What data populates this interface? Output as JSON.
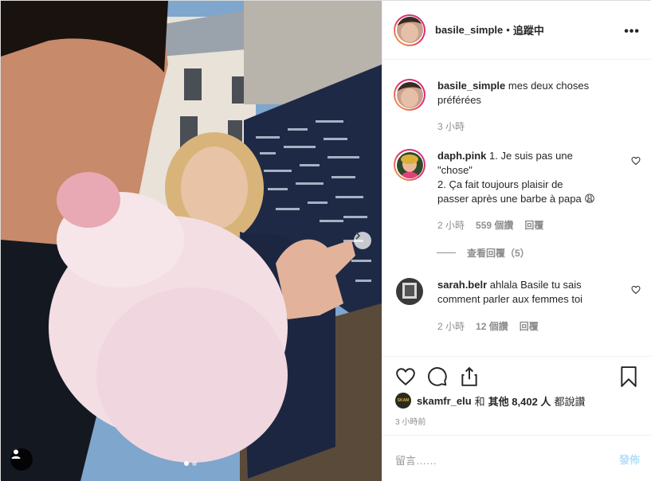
{
  "post": {
    "carousel": {
      "slide_count": 2,
      "active_slide": 1
    }
  },
  "header": {
    "username": "basile_simple",
    "separator": "•",
    "follow_status": "追蹤中",
    "more_icon": "more-horizontal-icon"
  },
  "caption": {
    "username": "basile_simple",
    "text": "mes deux choses préférées",
    "time": "3 小時"
  },
  "comments": [
    {
      "username": "daph.pink",
      "text_lines": [
        "1. Je suis pas une",
        "\"chose\"",
        "2. Ça fait toujours plaisir de",
        "passer après une barbe à papa 😩"
      ],
      "time": "2 小時",
      "likes": "559 個讚",
      "reply": "回覆",
      "view_replies": "查看回覆（5）"
    },
    {
      "username": "sarah.belr",
      "text_lines": [
        "ahlala Basile tu sais",
        "comment parler aux femmes toi"
      ],
      "time": "2 小時",
      "likes": "12 個讚",
      "reply": "回覆"
    }
  ],
  "likes_line": {
    "user": "skamfr_elu",
    "and": "和",
    "others": "其他 8,402 人",
    "suffix": "都說讚",
    "avatar_text": "SKAM"
  },
  "time_ago": "3 小時前",
  "add_comment": {
    "placeholder": "留言……",
    "post_label": "發佈"
  },
  "colors": {
    "story_ring": "#e1306c",
    "secondary_text": "#8e8e8e",
    "post_button_disabled": "#b2dffc"
  }
}
